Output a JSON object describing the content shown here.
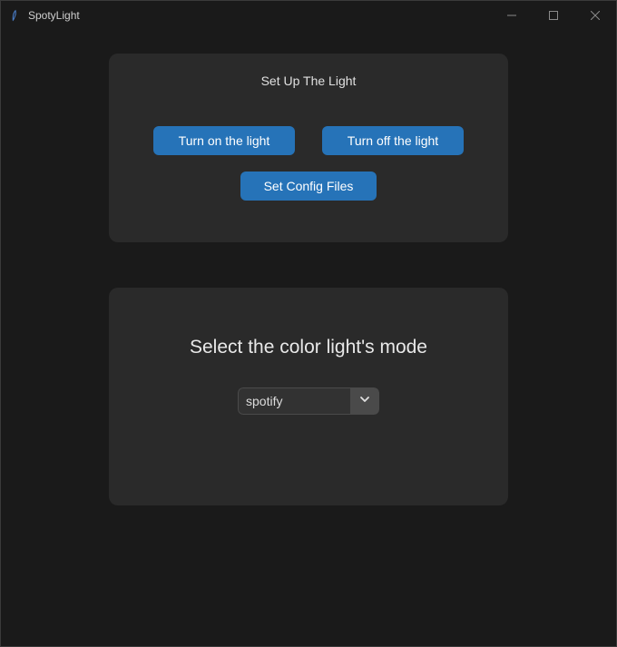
{
  "window": {
    "title": "SpotyLight"
  },
  "panel1": {
    "title": "Set Up The Light",
    "turn_on_label": "Turn on the light",
    "turn_off_label": "Turn off the light",
    "set_config_label": "Set Config Files"
  },
  "panel2": {
    "title": "Select the color light's mode",
    "dropdown_value": "spotify"
  }
}
